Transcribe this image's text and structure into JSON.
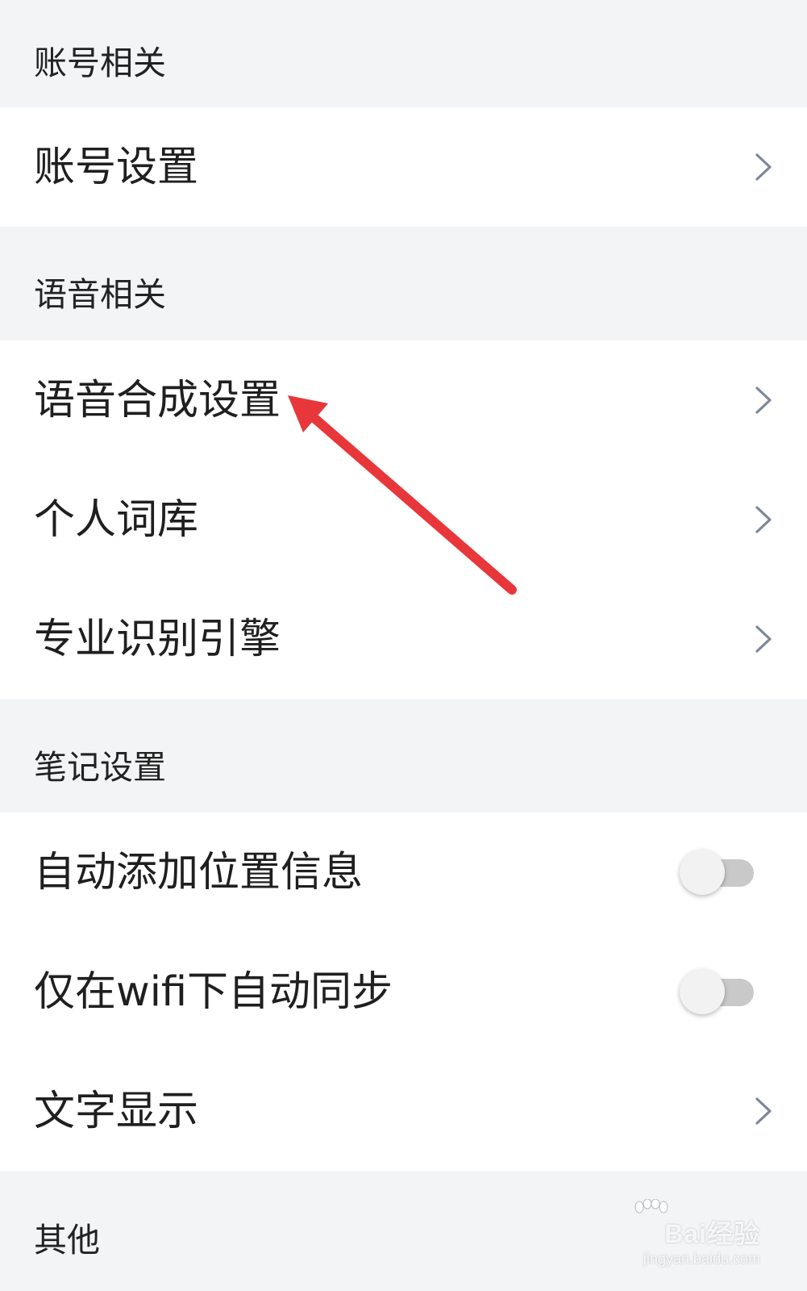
{
  "sections": [
    {
      "header": "账号相关",
      "rows": [
        {
          "label": "账号设置",
          "control": "chevron-right-icon"
        }
      ]
    },
    {
      "header": "语音相关",
      "rows": [
        {
          "label": "语音合成设置",
          "control": "chevron-right-icon"
        },
        {
          "label": "个人词库",
          "control": "chevron-right-icon"
        },
        {
          "label": "专业识别引擎",
          "control": "chevron-right-icon"
        }
      ]
    },
    {
      "header": "笔记设置",
      "rows": [
        {
          "label": "自动添加位置信息",
          "control": "toggle",
          "state": "off"
        },
        {
          "label": "仅在wifi下自动同步",
          "control": "toggle",
          "state": "off"
        },
        {
          "label": "文字显示",
          "control": "chevron-right-icon"
        }
      ]
    },
    {
      "header": "其他",
      "rows": []
    }
  ],
  "annotation": {
    "icon": "red-arrow-icon",
    "color": "#e8373a",
    "points_to": "语音合成设置"
  },
  "watermark": {
    "main": "Bai经验",
    "sub": "jingyan.baidu.com"
  },
  "colors": {
    "background": "#f3f4f6",
    "row_background": "#ffffff",
    "label_text": "#1f1f1f",
    "chevron": "#7d8799",
    "toggle_track_off": "#c9c9c9",
    "toggle_knob": "#f2f2f2"
  }
}
